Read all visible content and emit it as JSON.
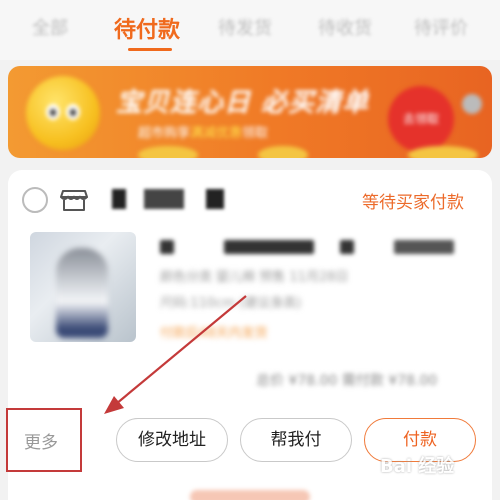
{
  "tabs": [
    {
      "label": "全部",
      "active": false
    },
    {
      "label": "待付款",
      "active": true
    },
    {
      "label": "待发货",
      "active": false
    },
    {
      "label": "待收货",
      "active": false
    },
    {
      "label": "待评价",
      "active": false
    }
  ],
  "banner": {
    "title": "宝贝连心日 必买清单",
    "subtitle_pre": "超市购享",
    "subtitle_highlight": "满减优惠",
    "subtitle_post": "领取",
    "button_label": "去领取"
  },
  "order": {
    "status": "等待买家付款",
    "product_lines": {
      "line2": "颜色分类 婴儿棉  预售 11月28日",
      "line3": "尺码:110cm (建议身高)",
      "line4": "付款后48天内发货"
    },
    "price_summary": "总价 ¥78.00  需付款 ¥78.00"
  },
  "actions": {
    "more_label": "更多",
    "change_address_label": "修改地址",
    "help_pay_label": "帮我付",
    "pay_label": "付款"
  },
  "watermark": "Bai 经验",
  "colors": {
    "accent": "#f06a1d",
    "annotation_red": "#c43a3a"
  }
}
